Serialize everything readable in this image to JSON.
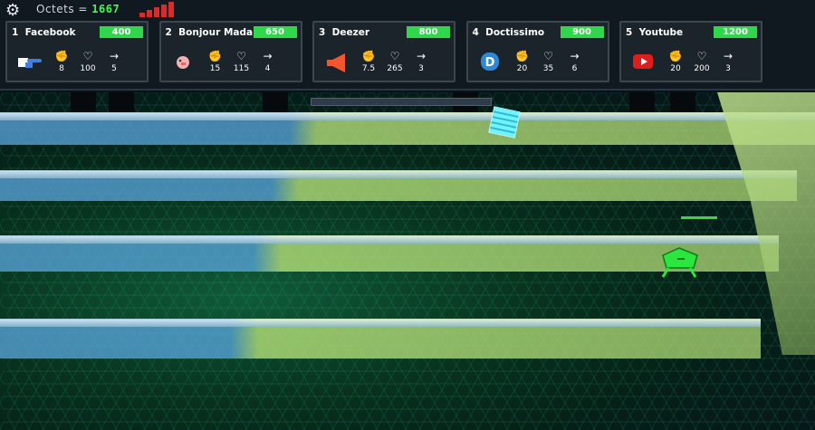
{
  "hud": {
    "gear_icon": "gear-icon",
    "octets_label": "Octets =",
    "octets_value": "1667",
    "signal_bars": 5,
    "signal_color": "#d82b2b"
  },
  "cards": [
    {
      "index": "1",
      "name": "Facebook",
      "cost": "400",
      "icon": "pointing-hand-icon",
      "attack": "8",
      "health": "100",
      "speed": "5"
    },
    {
      "index": "2",
      "name": "Bonjour Mada",
      "cost": "650",
      "icon": "pink-pig-icon",
      "attack": "15",
      "health": "115",
      "speed": "4"
    },
    {
      "index": "3",
      "name": "Deezer",
      "cost": "800",
      "icon": "orange-megaphone-icon",
      "attack": "7.5",
      "health": "265",
      "speed": "3"
    },
    {
      "index": "4",
      "name": "Doctissimo",
      "cost": "900",
      "icon": "blue-d-logo-icon",
      "attack": "20",
      "health": "35",
      "speed": "6"
    },
    {
      "index": "5",
      "name": "Youtube",
      "cost": "1200",
      "icon": "youtube-play-icon",
      "attack": "20",
      "health": "200",
      "speed": "3"
    }
  ],
  "stat_icons": {
    "attack": "fist-icon",
    "health": "heart-pulse-icon",
    "speed": "arrow-right-icon"
  },
  "colors": {
    "cost_badge": "#2fd84a",
    "wall_blue": "#5aa7e0",
    "wall_green": "#b7e37a",
    "enemy": "#27e33a"
  }
}
